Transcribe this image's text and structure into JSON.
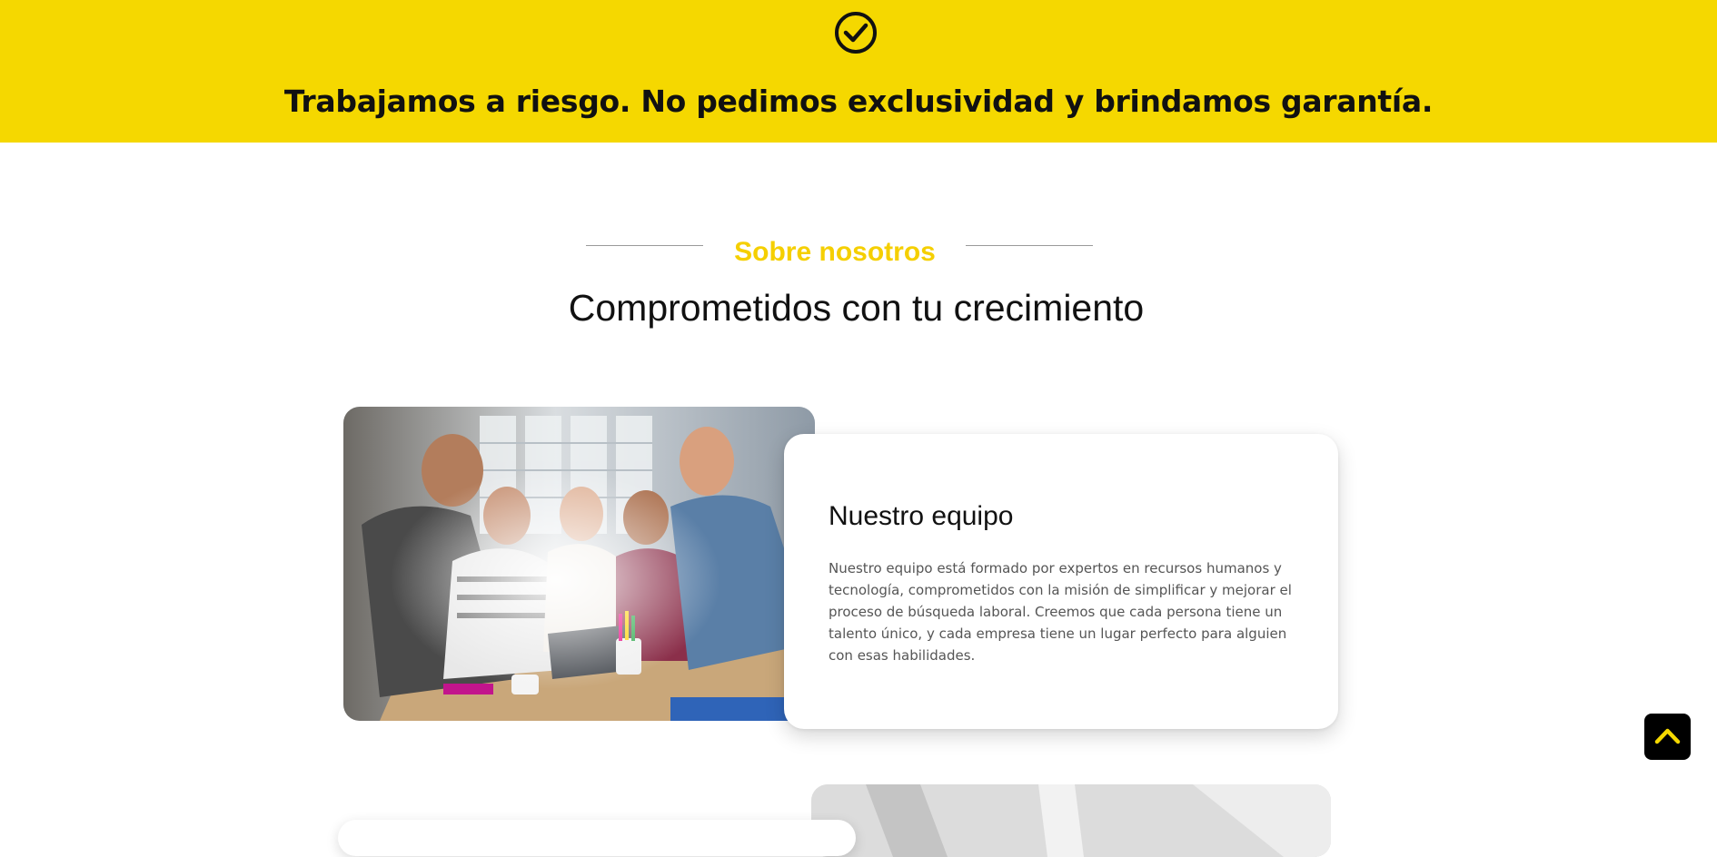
{
  "banner": {
    "icon": "check-circle-icon",
    "title": "Trabajamos a riesgo. No pedimos exclusividad y brindamos garantía.",
    "background_color": "#f5d800"
  },
  "about": {
    "eyebrow": "Sobre nosotros",
    "eyebrow_color": "#f5cf00",
    "title": "Comprometidos con tu crecimiento"
  },
  "team_card": {
    "image": "team-photo",
    "title": "Nuestro equipo",
    "text": "Nuestro equipo está formado por expertos en recursos humanos y tecnología, comprometidos con la misión de simplificar y mejorar el proceso de búsqueda laboral. Creemos que cada persona tiene un talento único, y cada empresa tiene un lugar perfecto para alguien con esas habilidades."
  },
  "scroll_top": {
    "icon": "chevron-up-icon",
    "color": "#f5d800"
  }
}
